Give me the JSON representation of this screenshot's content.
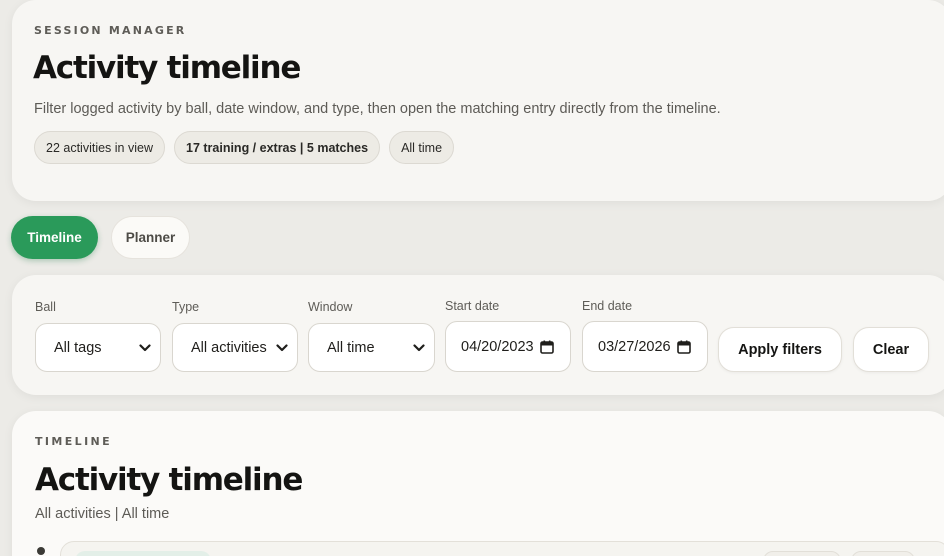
{
  "header": {
    "eyebrow": "SESSION MANAGER",
    "title": "Activity timeline",
    "description": "Filter logged activity by ball, date window, and type, then open the matching entry directly from the timeline.",
    "chips": [
      "22 activities in view",
      "17 training / extras | 5 matches",
      "All time"
    ]
  },
  "tabs": [
    {
      "label": "Timeline",
      "active": true
    },
    {
      "label": "Planner",
      "active": false
    }
  ],
  "filters": {
    "ball": {
      "label": "Ball",
      "value": "All tags"
    },
    "type": {
      "label": "Type",
      "value": "All activities"
    },
    "window": {
      "label": "Window",
      "value": "All time"
    },
    "start_date": {
      "label": "Start date",
      "value": "04/20/2023"
    },
    "end_date": {
      "label": "End date",
      "value": "03/27/2026"
    },
    "apply_label": "Apply filters",
    "clear_label": "Clear"
  },
  "timeline": {
    "eyebrow": "TIMELINE",
    "title": "Activity timeline",
    "subtitle": "All activities | All time"
  },
  "colors": {
    "accent": "#2a9a5a",
    "background": "#ecebe7",
    "card": "#f7f6f3"
  },
  "icons": {
    "select": "chevron-down-icon",
    "date": "calendar-icon"
  }
}
